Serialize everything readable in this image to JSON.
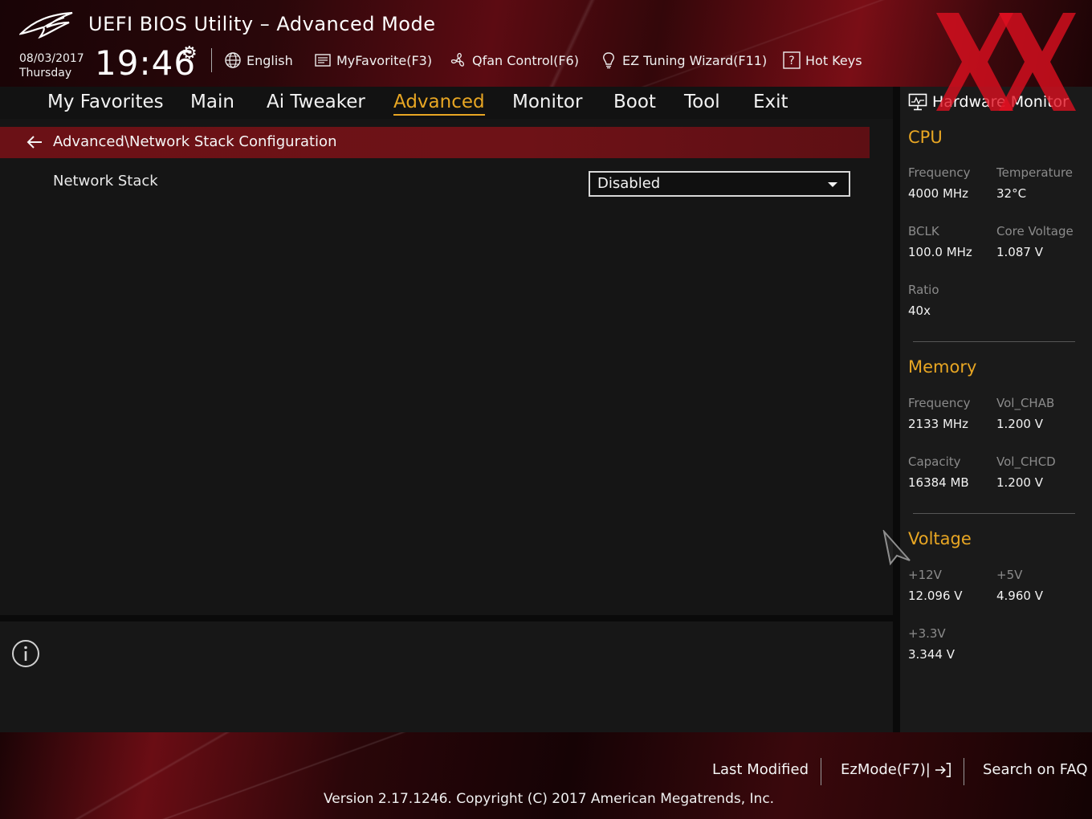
{
  "header": {
    "title": "UEFI BIOS Utility – Advanced Mode",
    "date": "08/03/2017",
    "day": "Thursday",
    "time": "19:46",
    "toolbar": [
      {
        "label": "English",
        "icon": "globe-icon"
      },
      {
        "label": "MyFavorite(F3)",
        "icon": "favorite-list-icon"
      },
      {
        "label": "Qfan Control(F6)",
        "icon": "fan-icon"
      },
      {
        "label": "EZ Tuning Wizard(F11)",
        "icon": "lightbulb-icon"
      },
      {
        "label": "Hot Keys",
        "icon": "question-icon"
      }
    ]
  },
  "nav": {
    "tabs": [
      "My Favorites",
      "Main",
      "Ai Tweaker",
      "Advanced",
      "Monitor",
      "Boot",
      "Tool",
      "Exit"
    ],
    "active": "Advanced"
  },
  "main": {
    "breadcrumb": "Advanced\\Network Stack Configuration",
    "settings": [
      {
        "label": "Network Stack",
        "value": "Disabled"
      }
    ]
  },
  "hardware_monitor": {
    "title": "Hardware Monitor",
    "cpu": {
      "heading": "CPU",
      "frequency_label": "Frequency",
      "frequency": "4000 MHz",
      "temperature_label": "Temperature",
      "temperature": "32°C",
      "bclk_label": "BCLK",
      "bclk": "100.0 MHz",
      "core_voltage_label": "Core Voltage",
      "core_voltage": "1.087 V",
      "ratio_label": "Ratio",
      "ratio": "40x"
    },
    "memory": {
      "heading": "Memory",
      "frequency_label": "Frequency",
      "frequency": "2133 MHz",
      "vol_chab_label": "Vol_CHAB",
      "vol_chab": "1.200 V",
      "capacity_label": "Capacity",
      "capacity": "16384 MB",
      "vol_chcd_label": "Vol_CHCD",
      "vol_chcd": "1.200 V"
    },
    "voltage": {
      "heading": "Voltage",
      "v12_label": "+12V",
      "v12": "12.096 V",
      "v5_label": "+5V",
      "v5": "4.960 V",
      "v33_label": "+3.3V",
      "v33": "3.344 V"
    }
  },
  "footer": {
    "last_modified": "Last Modified",
    "ezmode": "EzMode(F7)|",
    "search_faq": "Search on FAQ",
    "version": "Version 2.17.1246. Copyright (C) 2017 American Megatrends, Inc."
  },
  "colors": {
    "accent": "#e8a623",
    "breadcrumb_bar": "#6b1116",
    "watermark": "#e01020"
  }
}
